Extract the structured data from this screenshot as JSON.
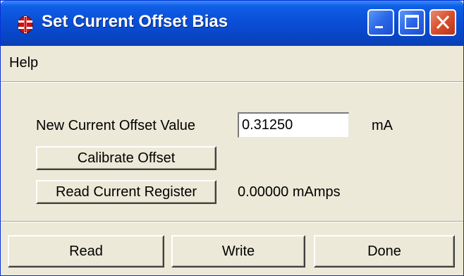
{
  "window": {
    "title": "Set Current Offset Bias",
    "icon": "red-circuit-icon",
    "controls": {
      "minimize": "minimize-icon",
      "maximize": "maximize-icon",
      "close": "close-icon"
    },
    "accent_color": "#0a4fd8",
    "close_color": "#d8502c",
    "face_color": "#ece9d8"
  },
  "menu": {
    "items": [
      "Help"
    ]
  },
  "form": {
    "new_value_label": "New Current Offset Value",
    "new_value": "0.31250",
    "unit": "mA",
    "calibrate_label": "Calibrate Offset",
    "read_register_label": "Read Current Register",
    "register_value": "0.00000 mAmps"
  },
  "footer": {
    "read_label": "Read",
    "write_label": "Write",
    "done_label": "Done"
  }
}
